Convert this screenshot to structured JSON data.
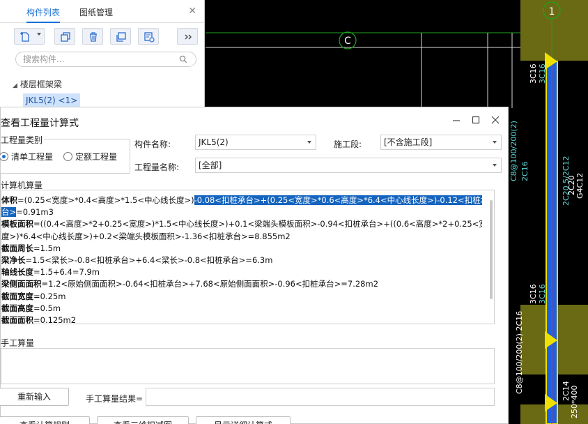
{
  "component_panel": {
    "tabs": [
      {
        "label": "构件列表"
      },
      {
        "label": "图纸管理"
      }
    ],
    "search_placeholder": "搜索构件...",
    "tree_group": "楼层框架梁",
    "tree_item": "JKL5(2) <1>"
  },
  "cad": {
    "axis_c": "C",
    "axis_1": "1",
    "labels": {
      "l1": "3C16",
      "l2": "3C16",
      "l3": "C8@100/200(2)",
      "l4": "2C16",
      "l5": "2C20 5/2C12",
      "l6": "2C20",
      "l7": "G4C12",
      "l8": "3C16",
      "l9": "3C16",
      "l10": "C8@100/200(2) 2C16",
      "l11": "2C14",
      "l12": "250*400"
    },
    "colors": {
      "column": "#6b6a14",
      "beam": "#1f5fe0",
      "marker": "#f0e000",
      "axis": "#1fa31f",
      "text": "#ffffff"
    }
  },
  "dialog": {
    "title": "查看工程量计算式",
    "qty_type_label": "工程量类别",
    "radio_list": "清单工程量",
    "radio_quota": "定额工程量",
    "comp_name_label": "构件名称:",
    "comp_name_value": "JKL5(2)",
    "stage_label": "施工段:",
    "stage_value": "[不含施工段]",
    "qty_name_label": "工程量名称:",
    "qty_name_value": "[全部]",
    "calc_label": "计算机算量",
    "calc_lines": {
      "l1_term": "体积",
      "l1_text": "=(0.25<宽度>*0.4<高度>*1.5<中心线长度>)",
      "l1_sel": "-0.08<扣桩承台>+(0.25<宽度>*0.6<高度>*6.4<中心线长度>)-0.12<扣桩承",
      "l2_sel": "台>",
      "l2_text": "=0.91m3",
      "l3_term": "模板面积",
      "l3_text": "=((0.4<高度>*2+0.25<宽度>)*1.5<中心线长度>)+0.1<梁端头模板面积>-0.94<扣桩承台>+((0.6<高度>*2+0.25<宽",
      "l4_text": "度>)*6.4<中心线长度>)+0.2<梁端头模板面积>-1.36<扣桩承台>=8.855m2",
      "l5_term": "截面周长",
      "l5_text": "=1.5m",
      "l6_term": "梁净长",
      "l6_text": "=1.5<梁长>-0.8<扣桩承台>+6.4<梁长>-0.8<扣桩承台>=6.3m",
      "l7_term": "轴线长度",
      "l7_text": "=1.5+6.4=7.9m",
      "l8_term": "梁侧面面积",
      "l8_text": "=1.2<原始侧面面积>-0.64<扣桩承台>+7.68<原始侧面面积>-0.96<扣桩承台>=7.28m2",
      "l9_term": "截面宽度",
      "l9_text": "=0.25m",
      "l10_term": "截面高度",
      "l10_text": "=0.5m",
      "l11_term": "截面面积",
      "l11_text": "=0.125m2"
    },
    "manual_label": "手工算量",
    "reinput_btn": "重新输入",
    "manual_result_label": "手工算量结果=",
    "bottom_buttons": [
      "查看计算规则",
      "查看三维扣减图",
      "显示详细计算式"
    ]
  }
}
